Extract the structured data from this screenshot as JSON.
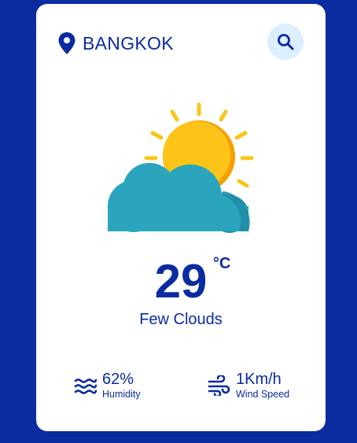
{
  "location": {
    "city": "BANGKOK",
    "icon": "map-pin-icon"
  },
  "search": {
    "icon": "search-icon"
  },
  "weather": {
    "icon": "sun-behind-cloud-icon",
    "temperature": "29",
    "unit": "°C",
    "condition": "Few Clouds"
  },
  "stats": {
    "humidity": {
      "value": "62%",
      "label": "Humidity",
      "icon": "humidity-waves-icon"
    },
    "wind": {
      "value": "1Km/h",
      "label": "Wind Speed",
      "icon": "wind-icon"
    }
  },
  "colors": {
    "background": "#0b2ba0",
    "card": "#ffffff",
    "accent": "#0b2ba0",
    "search_bg": "#dcefff",
    "sun": "#fcc419",
    "sun_shadow": "#f59f00",
    "cloud": "#2aa5bd",
    "cloud_shadow": "#1f8ea5"
  }
}
